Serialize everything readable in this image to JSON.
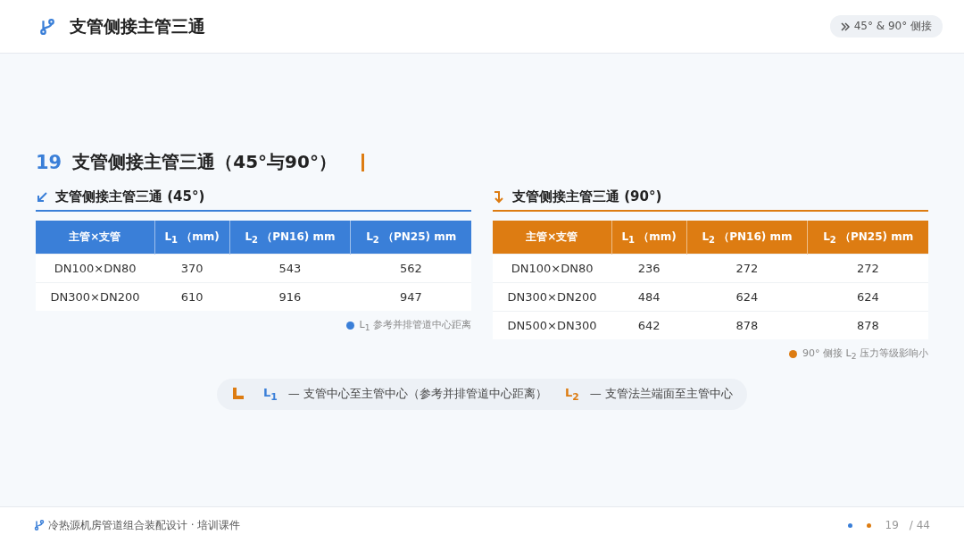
{
  "header": {
    "title": "支管侧接主管三通",
    "badge": "45° & 90° 侧接"
  },
  "section": {
    "number": "19",
    "title": "支管侧接主管三通（45°与90°）"
  },
  "tables": [
    {
      "kind": "diagonal",
      "title": "支管侧接主管三通 (45°)",
      "color": "#3a7fd8",
      "columns": [
        "主管×支管",
        "L$_{1}$ （mm)",
        "L$_{2}$ （PN16) mm",
        "L$_{2}$ （PN25) mm"
      ],
      "rows": [
        [
          "DN100×DN80",
          "370",
          "543",
          "562"
        ],
        [
          "DN300×DN200",
          "610",
          "916",
          "947"
        ]
      ],
      "note": "L$_{1}$ 参考并排管道中心距离"
    },
    {
      "kind": "elbow",
      "title": "支管侧接主管三通 (90°)",
      "color": "#dd7c12",
      "columns": [
        "主管×支管",
        "L$_{1}$ （mm)",
        "L$_{2}$ （PN16) mm",
        "L$_{2}$ （PN25) mm"
      ],
      "rows": [
        [
          "DN100×DN80",
          "236",
          "272",
          "272"
        ],
        [
          "DN300×DN200",
          "484",
          "624",
          "624"
        ],
        [
          "DN500×DN300",
          "642",
          "878",
          "878"
        ]
      ],
      "note": "90° 侧接 L$_{2}$ 压力等级影响小"
    }
  ],
  "legend": [
    {
      "symbol": "L$_{1}$",
      "color": "#3a7fd8",
      "text": "— 支管中心至主管中心（参考并排管道中心距离）"
    },
    {
      "symbol": "L$_{2}$",
      "color": "#dd7c12",
      "text": "— 支管法兰端面至主管中心"
    }
  ],
  "footer": {
    "title": "冷热源机房管道组合装配设计 · 培训课件",
    "dots": [
      {
        "color": "#3a7fd8"
      },
      {
        "color": "#dd7c12"
      }
    ],
    "page": "19",
    "total": "/ 44"
  }
}
